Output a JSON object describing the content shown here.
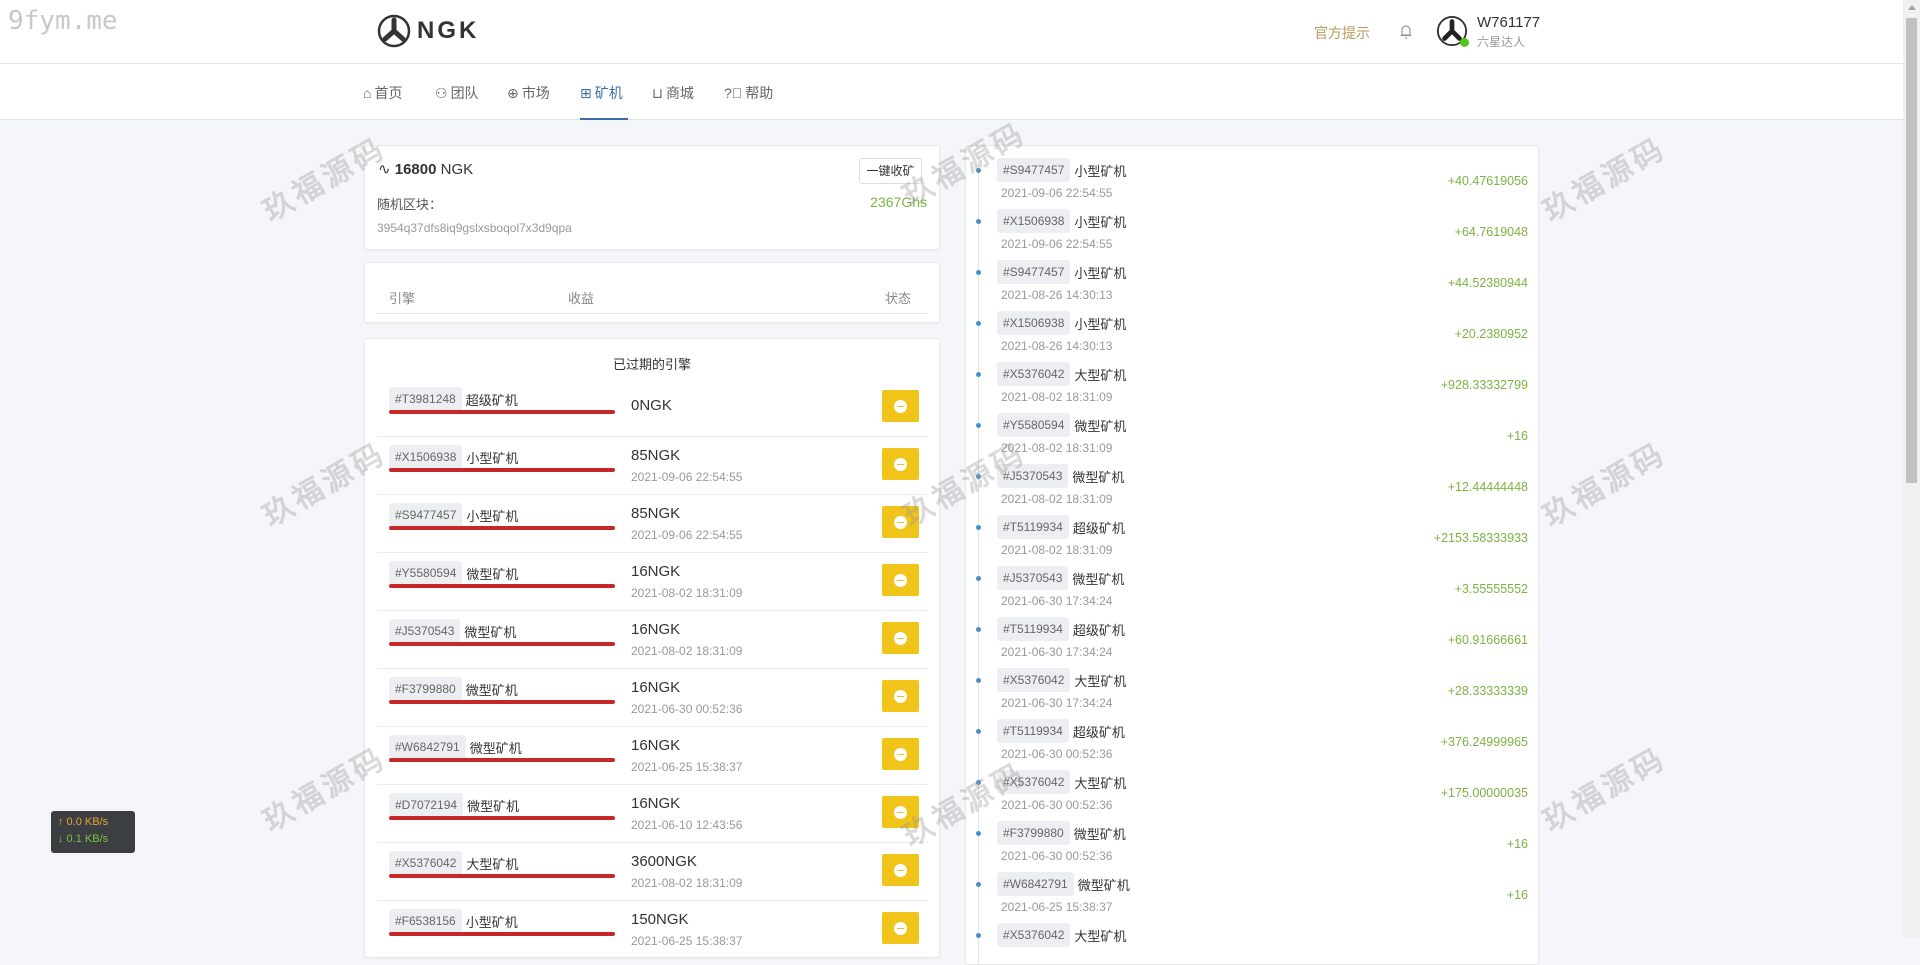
{
  "site_watermark": "9fym.me",
  "watermark_text": "玖福源码",
  "header": {
    "logo": "NGK",
    "hint": "官方提示",
    "username": "W761177",
    "level": "六星达人"
  },
  "nav": [
    {
      "label": "首页",
      "icon": "home-icon"
    },
    {
      "label": "团队",
      "icon": "users-icon"
    },
    {
      "label": "市场",
      "icon": "globe-icon"
    },
    {
      "label": "矿机",
      "icon": "chip-icon",
      "active": true
    },
    {
      "label": "商城",
      "icon": "cart-icon"
    },
    {
      "label": "帮助",
      "icon": "help-icon"
    }
  ],
  "summary": {
    "balance": "16800",
    "unit": "NGK",
    "collect_label": "一键收矿",
    "random_block_label": "随机区块：",
    "hashrate": "2367Ghs",
    "hash": "3954q37dfs8iq9gslxsboqol7x3d9qpa"
  },
  "table_headers": {
    "engine": "引擎",
    "income": "收益",
    "status": "状态"
  },
  "expired": {
    "title": "已过期的引擎",
    "rows": [
      {
        "id": "#T3981248",
        "type": "超级矿机",
        "amount": "0NGK",
        "date": ""
      },
      {
        "id": "#X1506938",
        "type": "小型矿机",
        "amount": "85NGK",
        "date": "2021-09-06 22:54:55"
      },
      {
        "id": "#S9477457",
        "type": "小型矿机",
        "amount": "85NGK",
        "date": "2021-09-06 22:54:55"
      },
      {
        "id": "#Y5580594",
        "type": "微型矿机",
        "amount": "16NGK",
        "date": "2021-08-02 18:31:09"
      },
      {
        "id": "#J5370543",
        "type": "微型矿机",
        "amount": "16NGK",
        "date": "2021-08-02 18:31:09"
      },
      {
        "id": "#F3799880",
        "type": "微型矿机",
        "amount": "16NGK",
        "date": "2021-06-30 00:52:36"
      },
      {
        "id": "#W6842791",
        "type": "微型矿机",
        "amount": "16NGK",
        "date": "2021-06-25 15:38:37"
      },
      {
        "id": "#D7072194",
        "type": "微型矿机",
        "amount": "16NGK",
        "date": "2021-06-10 12:43:56"
      },
      {
        "id": "#X5376042",
        "type": "大型矿机",
        "amount": "3600NGK",
        "date": "2021-08-02 18:31:09"
      },
      {
        "id": "#F6538156",
        "type": "小型矿机",
        "amount": "150NGK",
        "date": "2021-06-25 15:38:37"
      }
    ]
  },
  "history": [
    {
      "id": "#S9477457",
      "type": "小型矿机",
      "date": "2021-09-06 22:54:55",
      "income": "+40.47619056"
    },
    {
      "id": "#X1506938",
      "type": "小型矿机",
      "date": "2021-09-06 22:54:55",
      "income": "+64.7619048"
    },
    {
      "id": "#S9477457",
      "type": "小型矿机",
      "date": "2021-08-26 14:30:13",
      "income": "+44.52380944"
    },
    {
      "id": "#X1506938",
      "type": "小型矿机",
      "date": "2021-08-26 14:30:13",
      "income": "+20.2380952"
    },
    {
      "id": "#X5376042",
      "type": "大型矿机",
      "date": "2021-08-02 18:31:09",
      "income": "+928.33332799"
    },
    {
      "id": "#Y5580594",
      "type": "微型矿机",
      "date": "2021-08-02 18:31:09",
      "income": "+16"
    },
    {
      "id": "#J5370543",
      "type": "微型矿机",
      "date": "2021-08-02 18:31:09",
      "income": "+12.44444448"
    },
    {
      "id": "#T5119934",
      "type": "超级矿机",
      "date": "2021-08-02 18:31:09",
      "income": "+2153.58333933"
    },
    {
      "id": "#J5370543",
      "type": "微型矿机",
      "date": "2021-06-30 17:34:24",
      "income": "+3.55555552"
    },
    {
      "id": "#T5119934",
      "type": "超级矿机",
      "date": "2021-06-30 17:34:24",
      "income": "+60.91666661"
    },
    {
      "id": "#X5376042",
      "type": "大型矿机",
      "date": "2021-06-30 17:34:24",
      "income": "+28.33333339"
    },
    {
      "id": "#T5119934",
      "type": "超级矿机",
      "date": "2021-06-30 00:52:36",
      "income": "+376.24999965"
    },
    {
      "id": "#X5376042",
      "type": "大型矿机",
      "date": "2021-06-30 00:52:36",
      "income": "+175.00000035"
    },
    {
      "id": "#F3799880",
      "type": "微型矿机",
      "date": "2021-06-30 00:52:36",
      "income": "+16"
    },
    {
      "id": "#W6842791",
      "type": "微型矿机",
      "date": "2021-06-25 15:38:37",
      "income": "+16"
    },
    {
      "id": "#X5376042",
      "type": "大型矿机",
      "date": "",
      "income": ""
    }
  ],
  "speed": {
    "up": "↑ 0.0 KB/s",
    "down": "↓ 0.1 KB/s"
  }
}
